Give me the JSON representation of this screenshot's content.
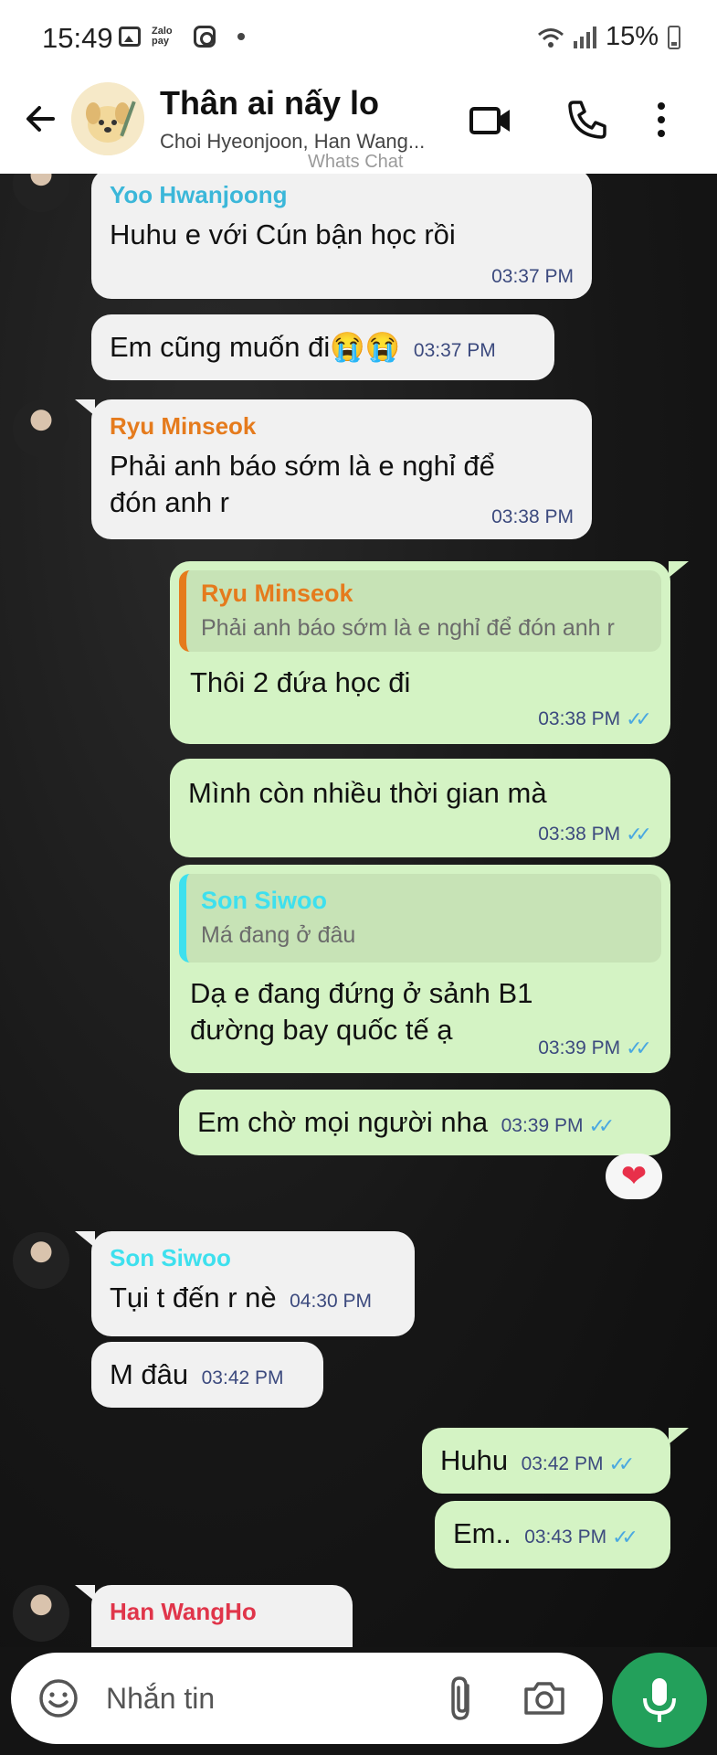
{
  "status_bar": {
    "time": "15:49",
    "zalo_label": "Zalo pay",
    "battery": "15%"
  },
  "header": {
    "title": "Thân ai nấy lo",
    "subtitle": "Choi Hyeonjoon, Han Wang...",
    "watermark": "Whats Chat"
  },
  "messages": [
    {
      "direction": "in",
      "sender": "Yoo Hwanjoong",
      "sender_color": "#3bb7d9",
      "text": "Huhu e với Cún bận học rồi",
      "time": "03:37 PM"
    },
    {
      "direction": "in",
      "text": "Em cũng muốn đi😭😭",
      "time": "03:37 PM"
    },
    {
      "direction": "in",
      "sender": "Ryu Minseok",
      "sender_color": "#e57b1d",
      "text": "Phải anh báo sớm là e nghỉ để đón anh r",
      "time": "03:38 PM"
    },
    {
      "direction": "out",
      "reply_to": {
        "name": "Ryu Minseok",
        "text": "Phải anh báo sớm là e nghỉ để đón anh r",
        "color": "#e57b1d"
      },
      "text": "Thôi 2 đứa học đi",
      "time": "03:38 PM"
    },
    {
      "direction": "out",
      "text": "Mình còn nhiều thời gian mà",
      "time": "03:38 PM"
    },
    {
      "direction": "out",
      "reply_to": {
        "name": "Son Siwoo",
        "text": "Má đang ở đâu",
        "color": "#3ee0ee"
      },
      "text": "Dạ e đang đứng ở sảnh B1 đường bay quốc tế ạ",
      "time": "03:39 PM"
    },
    {
      "direction": "out",
      "text": "Em chờ mọi người nha",
      "time": "03:39 PM",
      "reaction": "❤"
    },
    {
      "direction": "in",
      "sender": "Son Siwoo",
      "sender_color": "#3ee0ee",
      "text": "Tụi t đến r nè",
      "time": "04:30 PM"
    },
    {
      "direction": "in",
      "text": "M đâu",
      "time": "03:42 PM"
    },
    {
      "direction": "out",
      "text": "Huhu",
      "time": "03:42 PM"
    },
    {
      "direction": "out",
      "text": "Em..",
      "time": "03:43 PM"
    },
    {
      "direction": "in",
      "sender": "Han WangHo",
      "sender_color": "#e0354a"
    }
  ],
  "composer": {
    "placeholder": "Nhắn tin"
  },
  "icons": {
    "back": "arrow-left-icon",
    "video": "video-camera-icon",
    "call": "phone-icon",
    "more": "more-vertical-icon",
    "emoji": "emoji-icon",
    "attach": "paperclip-icon",
    "camera": "camera-icon",
    "mic": "microphone-icon"
  },
  "colors": {
    "incoming_bubble": "#f1f1f1",
    "outgoing_bubble": "#d4f3c4",
    "tick": "#4aa8e0",
    "mic_button": "#23a05b"
  }
}
